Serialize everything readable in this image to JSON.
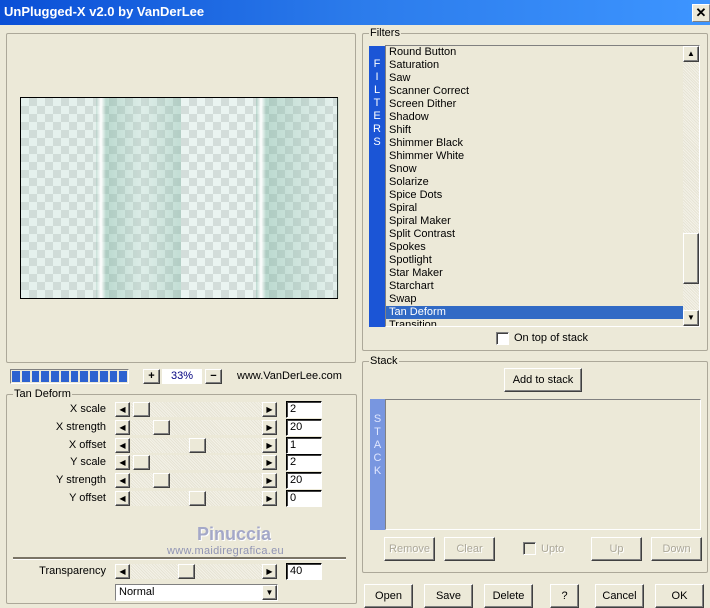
{
  "window": {
    "title": "UnPlugged-X v2.0 by VanDerLee",
    "close": "✕"
  },
  "preview": {
    "zoom": "33%",
    "zoom_in": "+",
    "zoom_out": "−",
    "website": "www.VanDerLee.com",
    "progress_blocks": 12
  },
  "params": {
    "group_label": "Tan Deform",
    "rows": [
      {
        "label": "X scale",
        "value": "2",
        "position": 0.0
      },
      {
        "label": "X strength",
        "value": "20",
        "position": 0.18
      },
      {
        "label": "X offset",
        "value": "1",
        "position": 0.5
      },
      {
        "label": "Y scale",
        "value": "2",
        "position": 0.0
      },
      {
        "label": "Y strength",
        "value": "20",
        "position": 0.18
      },
      {
        "label": "Y offset",
        "value": "0",
        "position": 0.5
      }
    ]
  },
  "watermark": {
    "name": "Pinuccia",
    "url": "www.maidiregrafica.eu"
  },
  "transparency": {
    "label": "Transparency",
    "value": "40",
    "position": 0.4
  },
  "blend_mode": {
    "value": "Normal"
  },
  "filters": {
    "group_label": "Filters",
    "strip": "FILTERS",
    "items": [
      "Round Button",
      "Saturation",
      "Saw",
      "Scanner Correct",
      "Screen Dither",
      "Shadow",
      "Shift",
      "Shimmer Black",
      "Shimmer White",
      "Snow",
      "Solarize",
      "Spice Dots",
      "Spiral",
      "Spiral Maker",
      "Split Contrast",
      "Spokes",
      "Spotlight",
      "Star Maker",
      "Starchart",
      "Swap",
      "Tan Deform",
      "Transition"
    ],
    "selected": "Tan Deform",
    "on_top_label": "On top of stack"
  },
  "stack": {
    "group_label": "Stack",
    "strip": "STACK",
    "add": "Add to stack",
    "remove": "Remove",
    "clear": "Clear",
    "upto": "Upto",
    "up": "Up",
    "down": "Down"
  },
  "footer": {
    "open": "Open",
    "save": "Save",
    "delete": "Delete",
    "help": "?",
    "cancel": "Cancel",
    "ok": "OK"
  },
  "colors": {
    "titlebar": "#2B7BEB",
    "selection": "#316AC5",
    "filters_strip": "#1B55D6",
    "stack_strip": "#7896E0"
  }
}
